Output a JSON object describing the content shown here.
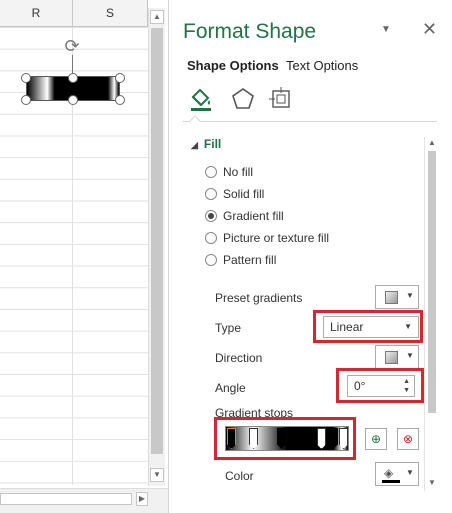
{
  "sheet": {
    "columns": [
      "R",
      "S"
    ]
  },
  "pane": {
    "title": "Format Shape",
    "menu_icon": "chevron-down",
    "close_icon": "close",
    "tabs": {
      "shape_options": "Shape Options",
      "text_options": "Text Options"
    },
    "categories": [
      "fill-line-icon",
      "effects-icon",
      "size-properties-icon"
    ],
    "section": "Fill",
    "fill_options": [
      {
        "label": "No fill",
        "selected": false
      },
      {
        "label": "Solid fill",
        "selected": false
      },
      {
        "label": "Gradient fill",
        "selected": true
      },
      {
        "label": "Picture or texture fill",
        "selected": false
      },
      {
        "label": "Pattern fill",
        "selected": false
      }
    ],
    "preset_gradients_label": "Preset gradients",
    "type_label": "Type",
    "type_value": "Linear",
    "direction_label": "Direction",
    "angle_label": "Angle",
    "angle_value": "0°",
    "gradient_stops_label": "Gradient stops",
    "color_label": "Color"
  },
  "colors": {
    "accent": "#217346",
    "highlight": "#d6262e"
  }
}
